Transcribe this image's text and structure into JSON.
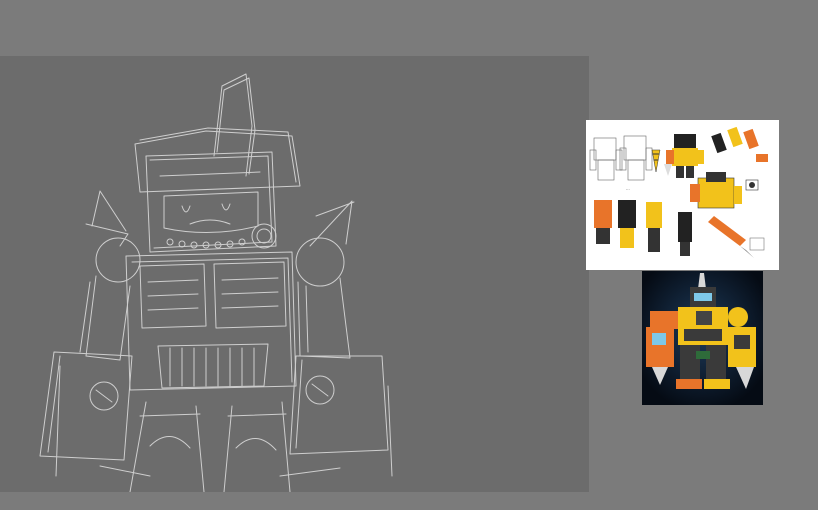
{
  "app": {
    "workspace_color": "#7b7b7b",
    "canvas_color": "#6c6c6c"
  },
  "canvas": {
    "content": "sketch-layer",
    "stroke_color": "#dcdcdc"
  },
  "reference_sheet": {
    "background": "#ffffff",
    "accent_colors": [
      "#f2c21b",
      "#e8742a",
      "#222222",
      "#d8d8d8"
    ]
  },
  "reference_render": {
    "background": "#0a1626",
    "accent_colors": [
      "#f2c21b",
      "#e8742a",
      "#3a3a3a",
      "#7ec8e8"
    ]
  }
}
